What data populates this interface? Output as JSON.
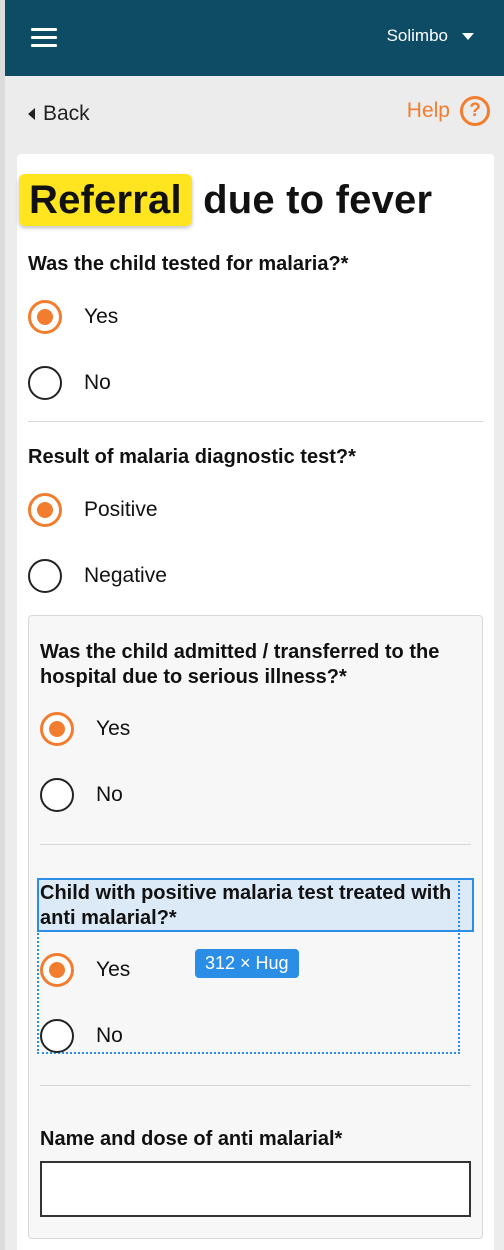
{
  "header": {
    "user_name": "Solimbo"
  },
  "nav": {
    "back_label": "Back",
    "help_label": "Help",
    "help_icon": "?"
  },
  "form": {
    "title_highlight": "Referral",
    "title_rest": " due to fever",
    "q1": {
      "label": "Was the child tested for malaria?*",
      "yes": "Yes",
      "no": "No",
      "selected": "Yes"
    },
    "q2": {
      "label": "Result of malaria diagnostic test?*",
      "positive": "Positive",
      "negative": "Negative",
      "selected": "Positive"
    },
    "q3": {
      "label": "Was the child admitted / transferred to the hospital due to serious illness?*",
      "yes": "Yes",
      "no": "No",
      "selected": "Yes"
    },
    "q4": {
      "label": "Child with positive malaria test treated with anti malarial?*",
      "yes": "Yes",
      "no": "No",
      "selected": "Yes"
    },
    "q5": {
      "label": "Name and dose of anti malarial*",
      "value": ""
    }
  },
  "design_overlay": {
    "size_label": "312 × Hug"
  },
  "colors": {
    "header_bg": "#0e4c66",
    "accent": "#f27d2e",
    "highlight": "#ffe51f",
    "selection": "#2a8ee6"
  }
}
